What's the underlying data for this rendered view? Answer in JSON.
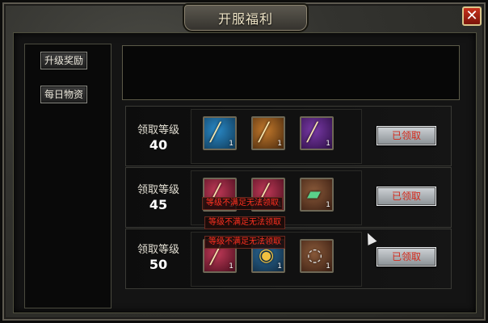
{
  "window": {
    "title": "开服福利",
    "close_label": "✕"
  },
  "side_tabs": [
    {
      "label": "升级奖励"
    },
    {
      "label": "每日物资"
    }
  ],
  "rows": [
    {
      "level_label": "领取等级",
      "level": "40",
      "items": [
        {
          "icon": "blue-sword-icon",
          "glyph": "╱",
          "count": "1"
        },
        {
          "icon": "orange-dagger-icon",
          "glyph": "╱",
          "count": "1"
        },
        {
          "icon": "purple-sword-icon",
          "glyph": "╱",
          "count": "1"
        }
      ],
      "button_label": "已领取"
    },
    {
      "level_label": "领取等级",
      "level": "45",
      "items": [
        {
          "icon": "red-sword-icon",
          "glyph": "╱",
          "count": "1"
        },
        {
          "icon": "pink-dagger-icon",
          "glyph": "╱",
          "count": "1"
        },
        {
          "icon": "jade-slab-icon",
          "glyph": "▰",
          "count": "1"
        }
      ],
      "button_label": "已领取",
      "warning": "等级不满足无法领取"
    },
    {
      "level_label": "领取等级",
      "level": "50",
      "items": [
        {
          "icon": "crimson-sword-icon",
          "glyph": "╱",
          "count": "1"
        },
        {
          "icon": "gold-shell-icon",
          "glyph": "◉",
          "count": "1"
        },
        {
          "icon": "silver-ring-icon",
          "glyph": "◌",
          "count": "1"
        }
      ],
      "button_label": "已领取",
      "warning": "等级不满足无法领取"
    }
  ],
  "floating_warning": "等级不满足无法领取"
}
